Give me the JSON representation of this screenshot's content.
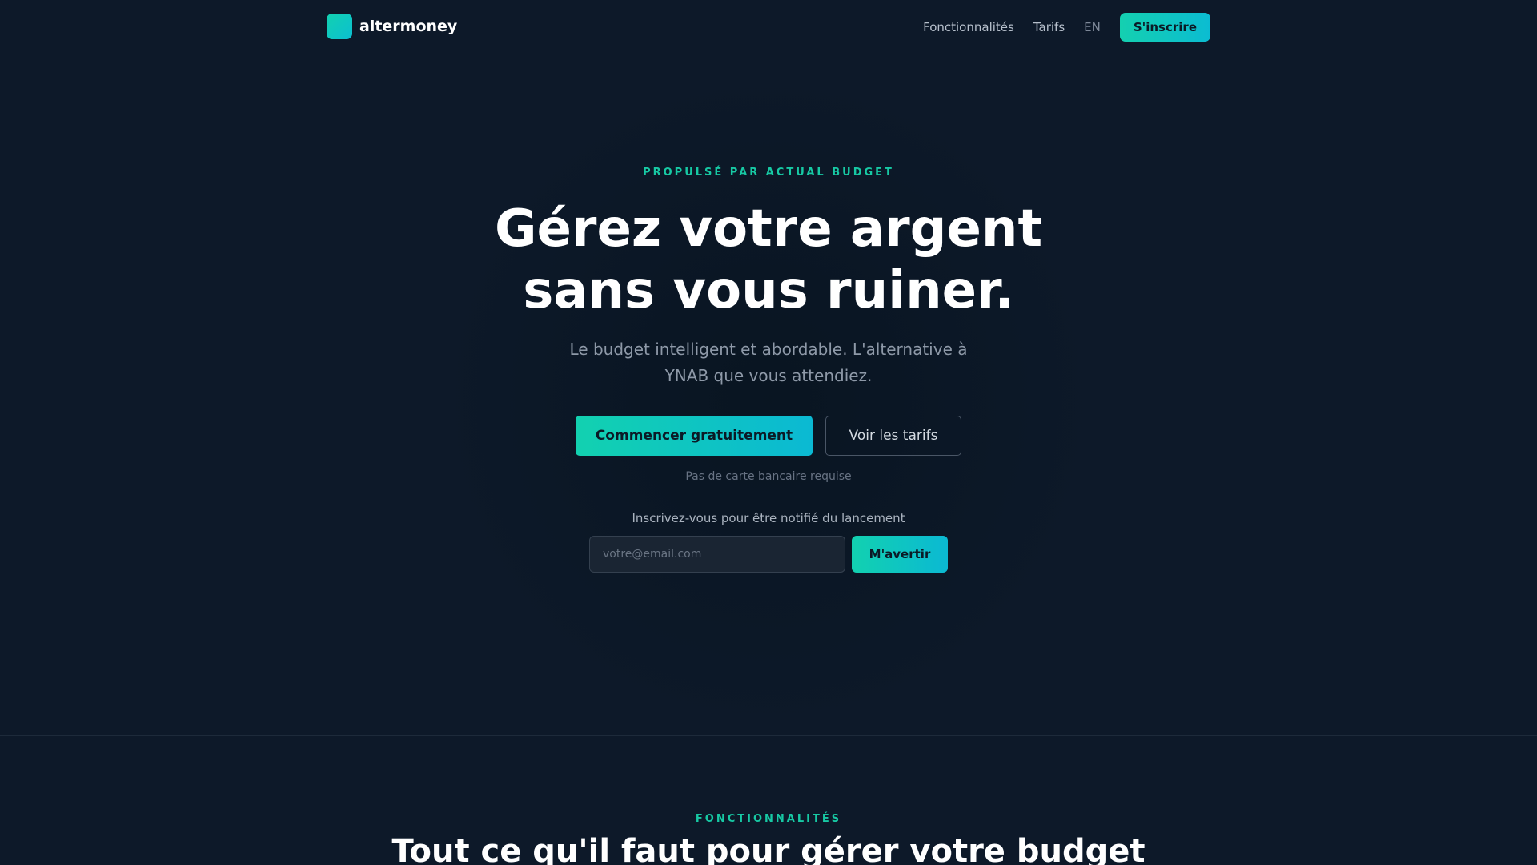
{
  "nav": {
    "brand": "altermoney",
    "links": [
      {
        "label": "Fonctionnalités"
      },
      {
        "label": "Tarifs"
      },
      {
        "label": "EN"
      }
    ],
    "signup_label": "S'inscrire"
  },
  "hero": {
    "eyebrow": "PROPULSÉ PAR ACTUAL BUDGET",
    "headline_line1": "Gérez votre argent",
    "headline_line2": "sans vous ruiner.",
    "subtitle_line1": "Le budget intelligent et abordable. L'alternative à",
    "subtitle_line2": "YNAB que vous attendiez.",
    "primary_cta": "Commencer gratuitement",
    "secondary_cta": "Voir les tarifs",
    "no_card": "Pas de carte bancaire requise",
    "notify_label": "Inscrivez-vous pour être notifié du lancement",
    "email_placeholder": "votre@email.com",
    "notify_button": "M'avertir"
  },
  "features": {
    "eyebrow": "FONCTIONNALITÉS",
    "title": "Tout ce qu'il faut pour gérer votre budget"
  },
  "colors": {
    "background": "#0d1929",
    "accent": "#14d0b0",
    "accent_secondary": "#0bbcd2",
    "eyebrow": "#17c9a4"
  }
}
